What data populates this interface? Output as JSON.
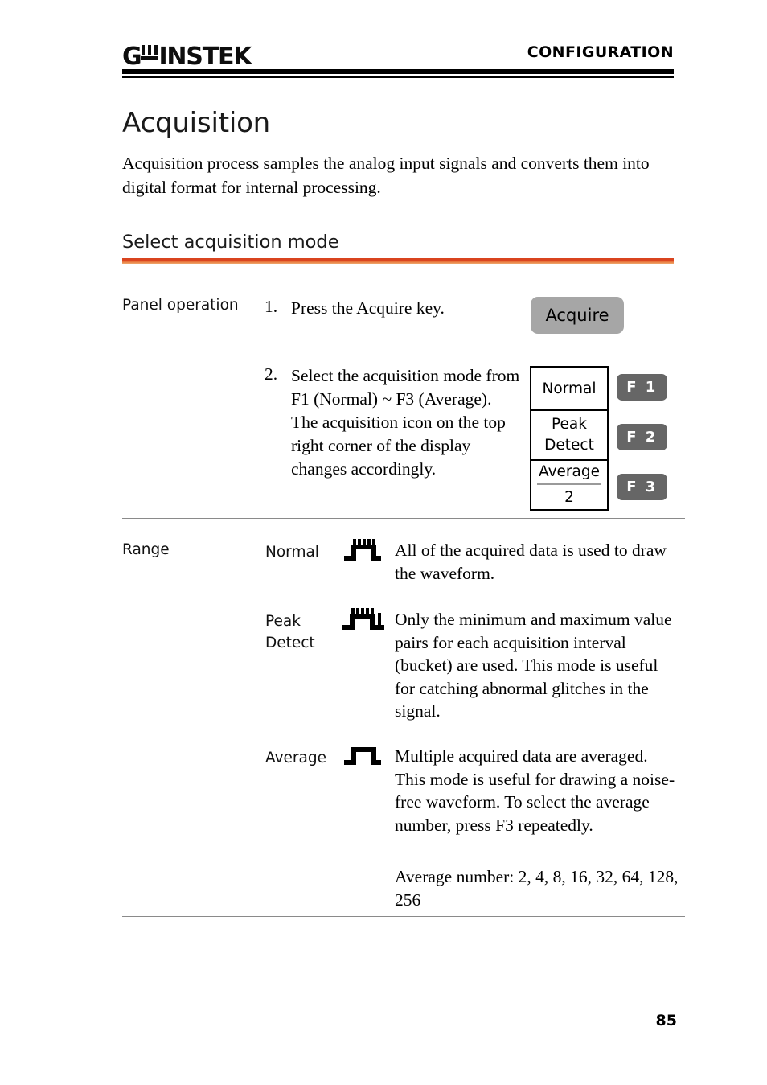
{
  "header": {
    "logo_gw": "G",
    "logo_instek": "INSTEK",
    "logo_full": "GW INSTEK",
    "section_title": "CONFIGURATION"
  },
  "title": "Acquisition",
  "intro": "Acquisition process samples the analog input signals and converts them into digital format for internal processing.",
  "subtitle": "Select acquisition mode",
  "panel": {
    "label": "Panel operation",
    "steps": [
      {
        "number": "1.",
        "text": "Press the Acquire key."
      },
      {
        "number": "2.",
        "text": "Select the acquisition mode from F1 (Normal) ~ F3 (Average). The acquisition icon on the top right corner of the display changes accordingly."
      }
    ],
    "acquire_key_label": "Acquire",
    "menu": {
      "items": [
        {
          "label": "Normal"
        },
        {
          "label": "Peak Detect",
          "line1": "Peak",
          "line2": "Detect"
        },
        {
          "label": "Average",
          "value": "2"
        }
      ]
    },
    "fkeys": [
      {
        "label": "F 1"
      },
      {
        "label": "F 2"
      },
      {
        "label": "F 3"
      }
    ]
  },
  "range": {
    "label": "Range",
    "modes": [
      {
        "name": "Normal",
        "icon": "square-pulse-serrated-icon",
        "description": "All of the acquired data is used to draw the waveform."
      },
      {
        "name_line1": "Peak",
        "name_line2": "Detect",
        "name": "Peak Detect",
        "icon": "square-pulse-serrated-spike-icon",
        "description": "Only the minimum and maximum value pairs for each acquisition interval (bucket) are used. This mode is useful for catching abnormal glitches in the signal."
      },
      {
        "name": "Average",
        "icon": "square-pulse-smooth-icon",
        "description": "Multiple acquired data are averaged. This mode is useful for drawing a noise-free waveform. To select the average number, press F3 repeatedly.",
        "description2": "Average number: 2, 4, 8, 16, 32, 64, 128, 256"
      }
    ]
  },
  "page_number": "85",
  "colors": {
    "accent_orange": "#d9441f",
    "accent_orange_light": "#eea96d",
    "key_gray": "#a6a6a6",
    "fkey_gray": "#666666",
    "rule_gray": "#8a8a8a"
  }
}
